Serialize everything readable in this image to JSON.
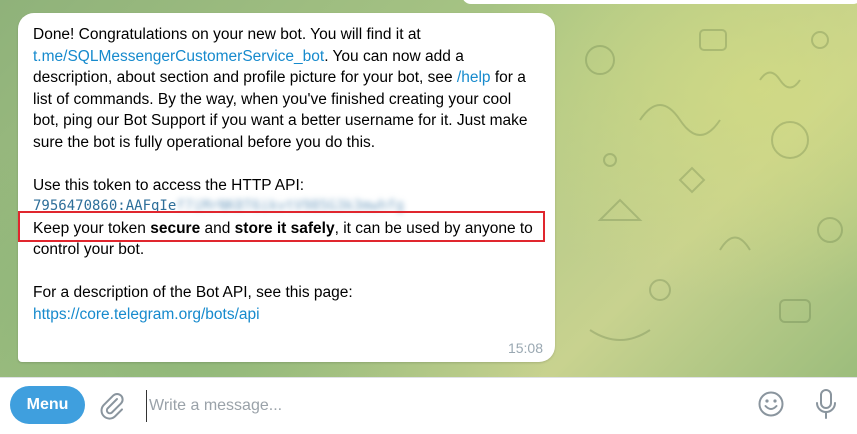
{
  "message": {
    "line1_prefix": "Done! Congratulations on your new bot. You will find it at",
    "bot_link": "t.me/SQLMessengerCustomerService_bot",
    "line2_suffix": ". You can now add a description, about section and profile picture for your bot, see",
    "help_link": "/help",
    "line3_rest": " for a list of commands. By the way, when you've finished creating your cool bot, ping our Bot Support if you want a better username for it. Just make sure the bot is fully operational before you do this.",
    "token_intro": "Use this token to access the HTTP API:",
    "token_visible": "7956470860:AAFqIe",
    "token_hidden": "f7iMrNK8T6ikvtV985G3k3mwhfg",
    "keep_prefix": "Keep your token ",
    "keep_bold1": "secure",
    "keep_mid": " and ",
    "keep_bold2": "store it safely",
    "keep_suffix": ", it can be used by anyone to control your bot.",
    "api_intro": "For a description of the Bot API, see this page:",
    "api_link": "https://core.telegram.org/bots/api",
    "time": "15:08"
  },
  "composer": {
    "menu_label": "Menu",
    "placeholder": "Write a message..."
  },
  "icons": {
    "attach": "paperclip-icon",
    "emoji": "smiley-icon",
    "voice": "microphone-icon"
  },
  "colors": {
    "link": "#168acd",
    "menu_button": "#3f9fde",
    "highlight_box": "#e0262e"
  }
}
